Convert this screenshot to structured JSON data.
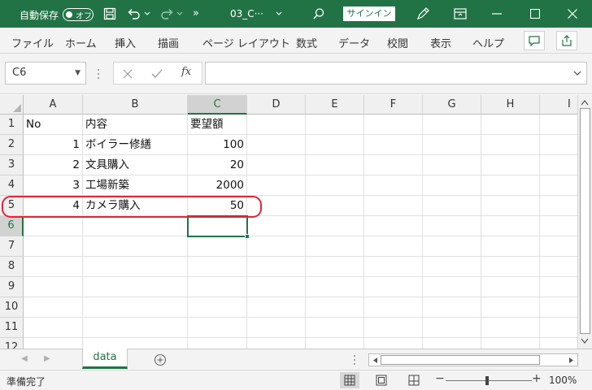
{
  "titlebar": {
    "autosave_label": "自動保存",
    "autosave_state": "オフ",
    "more": "»",
    "filename": "03_C···",
    "signin": "サインイン"
  },
  "ribbon": {
    "tabs": [
      "ファイル",
      "ホーム",
      "挿入",
      "描画",
      "ページ レイアウト",
      "数式",
      "データ",
      "校閲",
      "表示",
      "ヘルプ"
    ]
  },
  "formula_bar": {
    "name_box": "C6",
    "fx": "fx",
    "formula": ""
  },
  "sheet": {
    "columns": [
      "A",
      "B",
      "C",
      "D",
      "E",
      "F",
      "G",
      "H",
      "I"
    ],
    "rows": [
      "1",
      "2",
      "3",
      "4",
      "5",
      "6",
      "7",
      "8",
      "9",
      "10",
      "11",
      "12"
    ],
    "cells": [
      [
        "No",
        "内容",
        "要望額"
      ],
      [
        "1",
        "ボイラー修繕",
        "100"
      ],
      [
        "2",
        "文具購入",
        "20"
      ],
      [
        "3",
        "工場新築",
        "2000"
      ],
      [
        "4",
        "カメラ購入",
        "50"
      ]
    ],
    "active_cell": "C6",
    "highlighted_row": "5",
    "highlight_color": "#e0263a"
  },
  "sheet_tabs": {
    "active": "data"
  },
  "status": {
    "text": "準備完了",
    "zoom": "100%"
  },
  "colors": {
    "excel_green": "#217346"
  }
}
